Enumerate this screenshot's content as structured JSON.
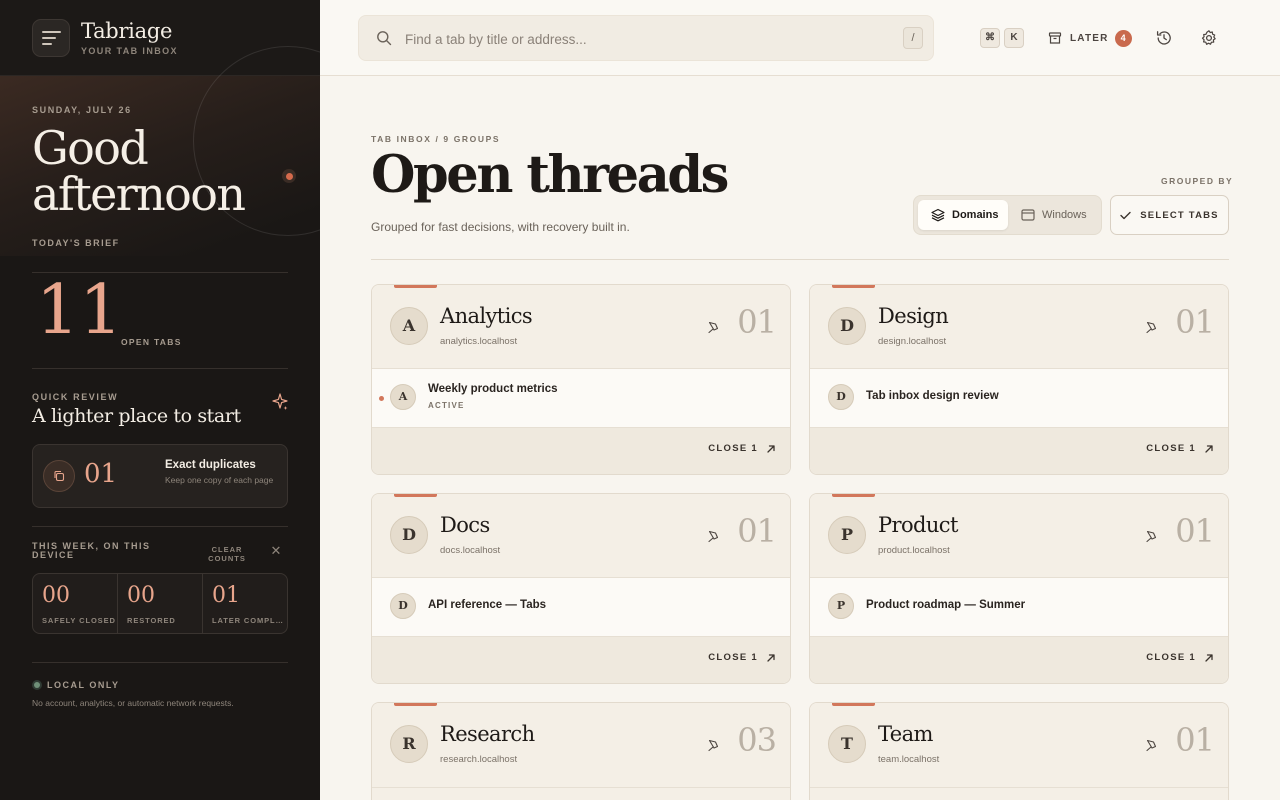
{
  "brand": {
    "name": "Tabriage",
    "tagline": "YOUR TAB INBOX"
  },
  "hero": {
    "date": "SUNDAY, JULY 26",
    "greeting": "Good afternoon"
  },
  "brief": {
    "label": "TODAY'S BRIEF",
    "open_tabs": "11",
    "open_tabs_label": "OPEN TABS"
  },
  "quick_review": {
    "label": "QUICK REVIEW",
    "title": "A lighter place to start",
    "duplicates": {
      "count": "01",
      "title": "Exact duplicates",
      "subtitle": "Keep one copy of each page"
    }
  },
  "week": {
    "label": "THIS WEEK, ON THIS DEVICE",
    "clear_label": "CLEAR COUNTS",
    "stats": [
      {
        "value": "00",
        "label": "SAFELY CLOSED"
      },
      {
        "value": "00",
        "label": "RESTORED"
      },
      {
        "value": "01",
        "label": "LATER COMPLETED"
      }
    ]
  },
  "privacy": {
    "label": "LOCAL ONLY",
    "subtitle": "No account, analytics, or automatic network requests."
  },
  "search": {
    "placeholder": "Find a tab by title or address...",
    "value": "",
    "shortcut": "/"
  },
  "shortcut_keys": [
    "⌘",
    "K"
  ],
  "later": {
    "label": "LATER",
    "badge": "4"
  },
  "icons": {
    "history": "history-icon",
    "settings": "gear-icon",
    "later": "archive-icon",
    "pin": "pin-icon",
    "close": "arrow-up-right-icon"
  },
  "main": {
    "breadcrumb": "TAB INBOX / 9 GROUPS",
    "title": "Open threads",
    "subtitle": "Grouped for fast decisions, with recovery built in.",
    "grouped_by_label": "GROUPED BY",
    "group_options": [
      "Domains",
      "Windows"
    ],
    "selected_group_option": "Domains",
    "select_tabs_label": "SELECT TABS"
  },
  "groups": [
    {
      "letter": "A",
      "name": "Analytics",
      "domain": "analytics.localhost",
      "count": "01",
      "tab": {
        "letter": "A",
        "title": "Weekly product metrics",
        "status": "ACTIVE"
      },
      "close_label": "CLOSE 1"
    },
    {
      "letter": "D",
      "name": "Design",
      "domain": "design.localhost",
      "count": "01",
      "tab": {
        "letter": "D",
        "title": "Tab inbox design review"
      },
      "close_label": "CLOSE 1"
    },
    {
      "letter": "D",
      "name": "Docs",
      "domain": "docs.localhost",
      "count": "01",
      "tab": {
        "letter": "D",
        "title": "API reference — Tabs"
      },
      "close_label": "CLOSE 1"
    },
    {
      "letter": "P",
      "name": "Product",
      "domain": "product.localhost",
      "count": "01",
      "tab": {
        "letter": "P",
        "title": "Product roadmap — Summer"
      },
      "close_label": "CLOSE 1"
    },
    {
      "letter": "R",
      "name": "Research",
      "domain": "research.localhost",
      "count": "03"
    },
    {
      "letter": "T",
      "name": "Team",
      "domain": "team.localhost",
      "count": "01"
    }
  ],
  "colors": {
    "accent": "#d2775b",
    "sidebar_bg": "#1a1715",
    "page_bg": "#f8f5ef",
    "badge": "#c96a4d"
  }
}
